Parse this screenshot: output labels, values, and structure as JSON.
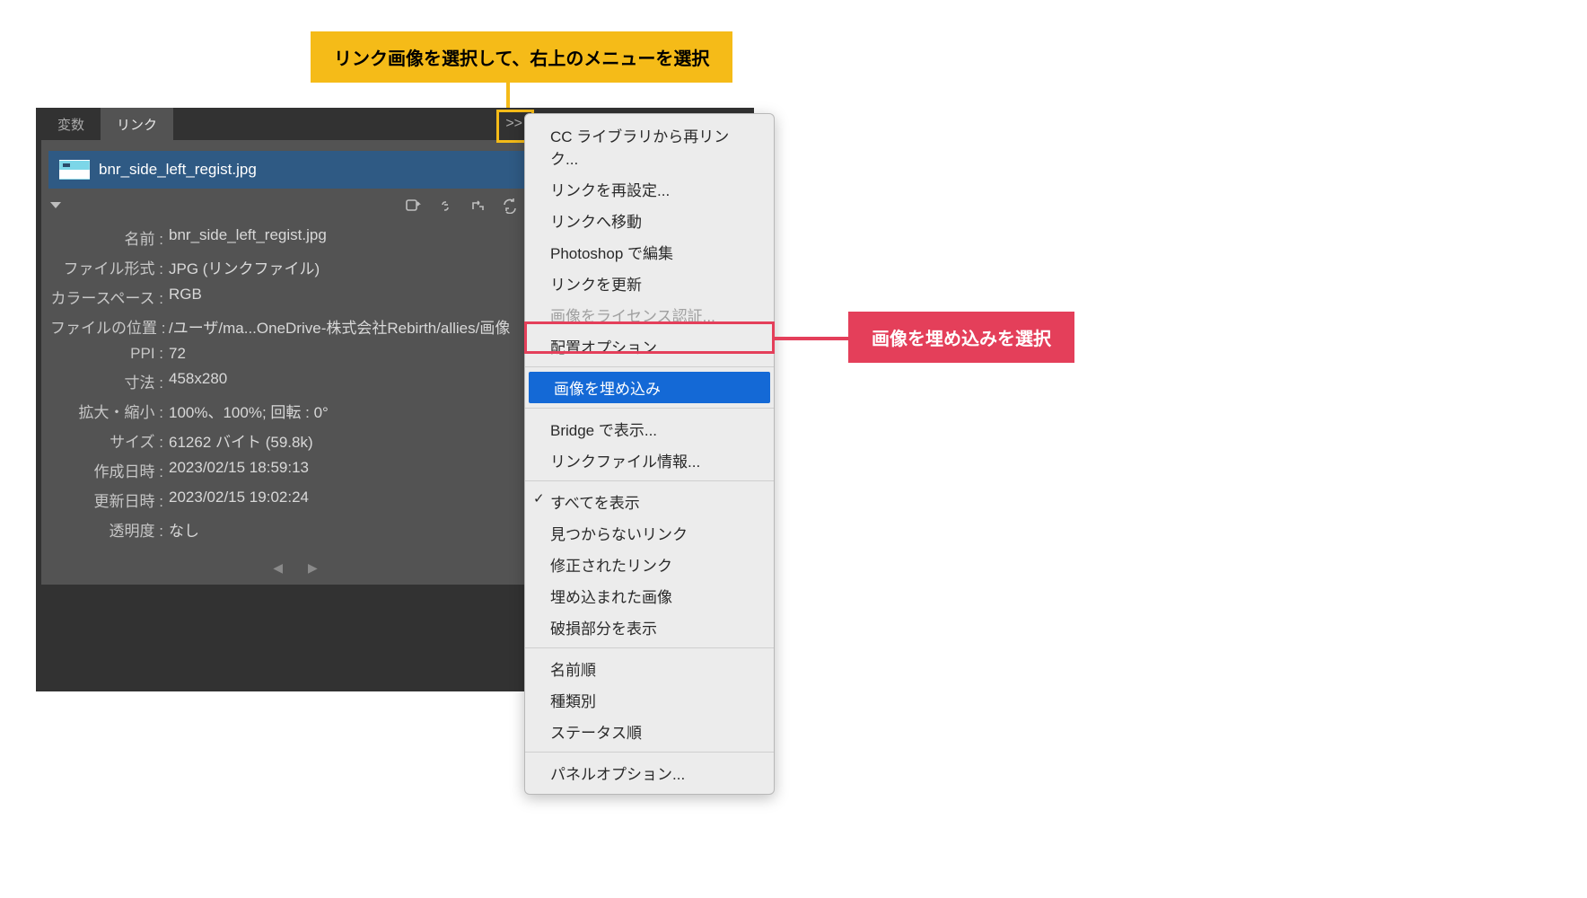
{
  "callouts": {
    "top": "リンク画像を選択して、右上のメニューを選択",
    "right": "画像を埋め込みを選択"
  },
  "panel": {
    "tabs": {
      "inactive": "変数",
      "active": "リンク"
    },
    "chevrons": ">>",
    "link_row": {
      "filename": "bnr_side_left_regist.jpg",
      "badge": "⎘"
    },
    "details": {
      "rows": [
        {
          "label": "名前 :",
          "value": "bnr_side_left_regist.jpg"
        },
        {
          "label": "ファイル形式 :",
          "value": "JPG (リンクファイル)"
        },
        {
          "label": "カラースペース :",
          "value": "RGB"
        },
        {
          "label": "ファイルの位置 :",
          "value": "/ユーザ/ma...OneDrive-株式会社Rebirth/allies/画像"
        },
        {
          "label": "PPI :",
          "value": "72"
        },
        {
          "label": "寸法 :",
          "value": "458x280"
        },
        {
          "label": "拡大・縮小 :",
          "value": "100%、100%; 回転 : 0°"
        },
        {
          "label": "サイズ :",
          "value": "61262 バイト (59.8k)"
        },
        {
          "label": "作成日時 :",
          "value": "2023/02/15 18:59:13"
        },
        {
          "label": "更新日時 :",
          "value": "2023/02/15 19:02:24"
        },
        {
          "label": "透明度 :",
          "value": "なし"
        }
      ]
    },
    "nav_arrows": "◀   ▶"
  },
  "menu": {
    "groups": [
      [
        {
          "label": "CC ライブラリから再リンク...",
          "state": "normal"
        },
        {
          "label": "リンクを再設定...",
          "state": "normal"
        },
        {
          "label": "リンクへ移動",
          "state": "normal"
        },
        {
          "label": "Photoshop で編集",
          "state": "normal"
        },
        {
          "label": "リンクを更新",
          "state": "normal"
        },
        {
          "label": "画像をライセンス認証...",
          "state": "disabled"
        },
        {
          "label": "配置オプション...",
          "state": "normal"
        }
      ],
      [
        {
          "label": "画像を埋め込み",
          "state": "highlight"
        }
      ],
      [
        {
          "label": "Bridge で表示...",
          "state": "normal"
        },
        {
          "label": "リンクファイル情報...",
          "state": "normal"
        }
      ],
      [
        {
          "label": "すべてを表示",
          "state": "checked"
        },
        {
          "label": "見つからないリンク",
          "state": "normal"
        },
        {
          "label": "修正されたリンク",
          "state": "normal"
        },
        {
          "label": "埋め込まれた画像",
          "state": "normal"
        },
        {
          "label": "破損部分を表示",
          "state": "normal"
        }
      ],
      [
        {
          "label": "名前順",
          "state": "normal"
        },
        {
          "label": "種類別",
          "state": "normal"
        },
        {
          "label": "ステータス順",
          "state": "normal"
        }
      ],
      [
        {
          "label": "パネルオプション...",
          "state": "normal"
        }
      ]
    ]
  }
}
